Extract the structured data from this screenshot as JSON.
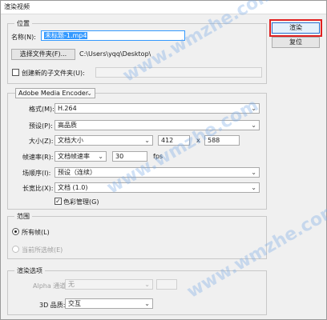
{
  "window": {
    "title": "渲染视频"
  },
  "buttons": {
    "render": "渲染",
    "reset": "复位"
  },
  "location": {
    "group_title": "位置",
    "name_label": "名称(N):",
    "name_value": "未标题-1.mp4",
    "choose_folder_button": "选择文件夹(F)...",
    "folder_path": "C:\\Users\\yqq\\Desktop\\",
    "create_subfolder_label": "创建新的子文件夹(U):",
    "create_subfolder_checked": false,
    "subfolder_value": ""
  },
  "encoder": {
    "selected": "Adobe Media Encoder",
    "format_label": "格式(M):",
    "format_value": "H.264",
    "preset_label": "预设(P):",
    "preset_value": "高品质",
    "size_label": "大小(Z):",
    "size_value": "文档大小",
    "width": "412",
    "times": "x",
    "height": "588",
    "framerate_label": "帧速率(R):",
    "framerate_value": "文档帧速率",
    "fps_value": "30",
    "fps_unit": "fps",
    "field_order_label": "场顺序(I):",
    "field_order_value": "预设（连续）",
    "aspect_label": "长宽比(X):",
    "aspect_value": "文档 (1.0)",
    "color_manage_label": "色彩管理(G)",
    "color_manage_checked": true
  },
  "range": {
    "group_title": "范围",
    "all_frames_label": "所有帧(L)",
    "current_frame_label": "当前所选帧(E)",
    "selected": "all_frames"
  },
  "render_options": {
    "group_title": "渲染选项",
    "alpha_label": "Alpha 通道(P):",
    "alpha_value": "无",
    "quality_label": "3D 品质:",
    "quality_value": "交互"
  },
  "watermarks": [
    "www.wmzhe.com",
    "www.wmzhe.com",
    "www.wmzhe.com"
  ],
  "icons": {
    "dropdown": "chevron-down-icon",
    "check": "checkmark-icon"
  }
}
